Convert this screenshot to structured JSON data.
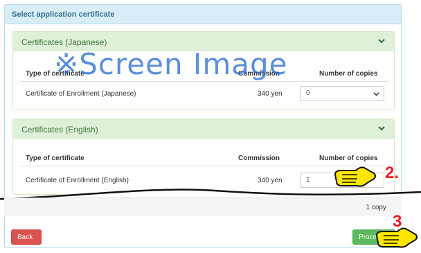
{
  "main_panel": {
    "title": "Select application certificate"
  },
  "japanese_panel": {
    "title": "Certificates (Japanese)",
    "headers": [
      "Type of certificate",
      "Commission",
      "Number of copies"
    ],
    "row": {
      "type": "Certificate of Enrollment (Japanese)",
      "commission": "340 yen",
      "copies": "0"
    }
  },
  "english_panel": {
    "title": "Certificates (English)",
    "headers": [
      "Type of certificate",
      "Commission",
      "Number of copies"
    ],
    "row": {
      "type": "Certificate of Enrollment (English)",
      "commission": "340 yen",
      "copies": "1"
    }
  },
  "footer": {
    "copy_count": "1 copy"
  },
  "buttons": {
    "back": "Back",
    "proceed": "Proceed"
  },
  "annotations": {
    "watermark": "※Screen Image",
    "step2": "2.",
    "step3": "3"
  },
  "colors": {
    "accent_red": "#ee1c25",
    "proceed_green": "#5cb85c",
    "back_red": "#d9534f",
    "header_blue": "#d9edf7",
    "panel_green": "#dff0d8",
    "hand_yellow": "#ffe600"
  },
  "icons": [
    "chevron-down-icon",
    "dropdown-arrow-icon",
    "pointing-hand-icon"
  ]
}
